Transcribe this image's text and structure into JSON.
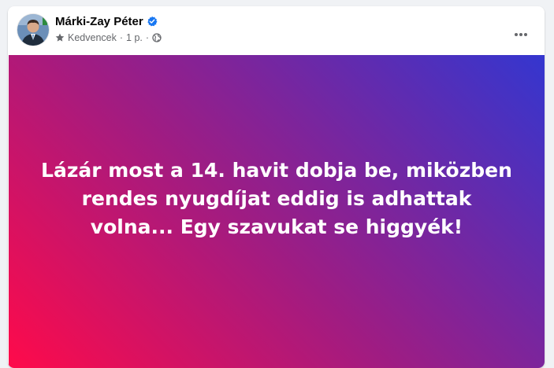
{
  "post": {
    "author": {
      "name": "Márki-Zay Péter",
      "verified": true,
      "avatar_icon": "profile-photo"
    },
    "meta": {
      "audience_label": "Kedvencek",
      "separator": "·",
      "time": "1 p.",
      "privacy_icon": "globe-icon",
      "favorite_icon": "star-icon"
    },
    "menu_icon": "more-options-icon",
    "text": "Lázár most a 14. havit dobja be, miközben rendes nyugdíjat eddig is adhattak volna... Egy szavukat se higgyék!",
    "background_colors": {
      "start": "#ff0a4a",
      "middle": "#a01c82",
      "end": "#3436cf"
    }
  }
}
